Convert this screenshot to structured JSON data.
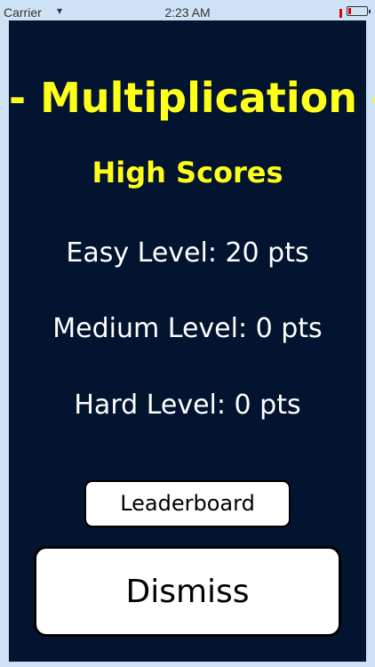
{
  "status_bar": {
    "carrier": "Carrier",
    "wifi_icon": "wifi-icon",
    "time": "2:23 AM",
    "battery_icon": "battery-icon",
    "battery_level_fraction": 0.1
  },
  "screen": {
    "title": "- Multiplication -",
    "subtitle": "High Scores",
    "scores": {
      "easy": "Easy Level: 20 pts",
      "medium": "Medium Level: 0 pts",
      "hard": "Hard Level: 0 pts"
    },
    "buttons": {
      "leaderboard": "Leaderboard",
      "dismiss": "Dismiss"
    }
  },
  "colors": {
    "panel_background": "#02142f",
    "title_yellow": "#ffff1a",
    "score_text": "#ffffff",
    "outer_background": "#cfe3f6"
  }
}
